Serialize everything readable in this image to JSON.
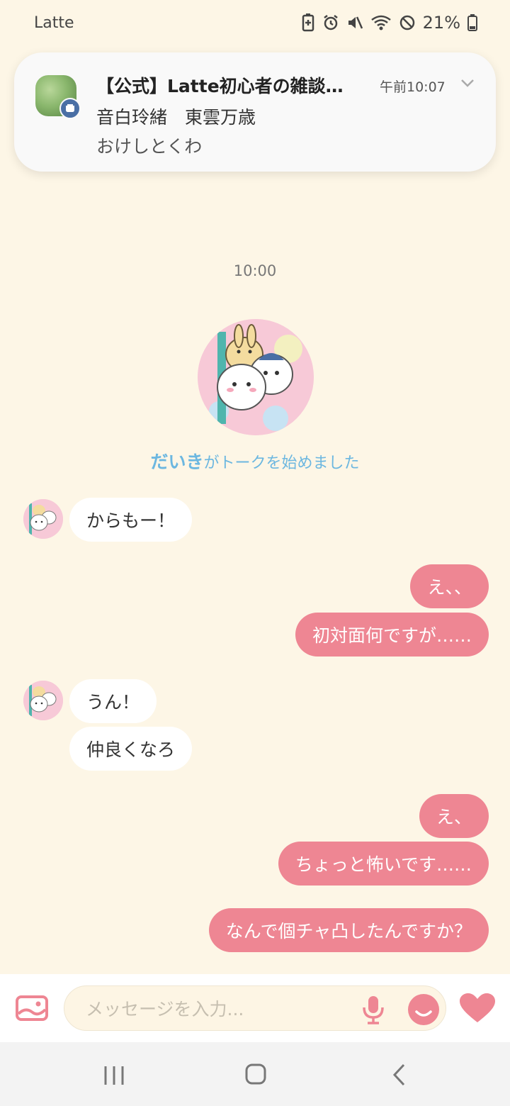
{
  "status_bar": {
    "app_name": "Latte",
    "battery_percent": "21%"
  },
  "notification": {
    "title": "【公式】Latte初心者の雑談…",
    "time": "午前10:07",
    "line2": "音白玲緒　東雲万歳",
    "line3": "おけしとくわ"
  },
  "chat": {
    "time_label": "10:00",
    "starter_name": "だいき",
    "starter_suffix": "がトークを始めました",
    "messages": [
      {
        "side": "in",
        "text": "からもー！"
      },
      {
        "side": "out",
        "text": "え、、"
      },
      {
        "side": "out",
        "text": "初対面何ですが……"
      },
      {
        "side": "in",
        "text": "うん！"
      },
      {
        "side": "in",
        "text": "仲良くなろ"
      },
      {
        "side": "out",
        "text": "え、"
      },
      {
        "side": "out",
        "text": "ちょっと怖いです……"
      },
      {
        "side": "out",
        "text": "なんで個チャ凸したんですか？"
      }
    ]
  },
  "input": {
    "placeholder": "メッセージを入力..."
  },
  "colors": {
    "background": "#fdf6e6",
    "outgoing_bubble": "#ee8693",
    "incoming_bubble": "#ffffff",
    "accent_blue": "#6cb7e0"
  },
  "icons": [
    "gallery-icon",
    "mic-icon",
    "emoji-icon",
    "heart-icon",
    "recent-apps-icon",
    "home-icon",
    "back-icon",
    "chevron-down-icon"
  ]
}
